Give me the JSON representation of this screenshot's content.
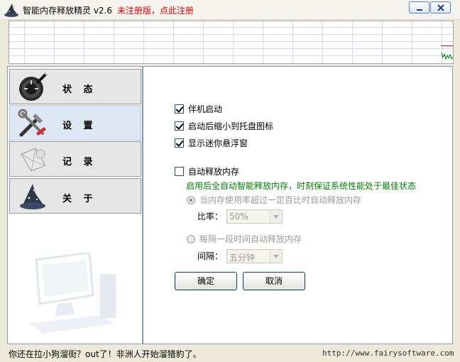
{
  "window": {
    "title": "智能内存释放精灵 v2.6",
    "register_link": "未注册版，点此注册"
  },
  "sidebar": {
    "items": [
      {
        "label": "状 态",
        "icon": "gauge-wand-icon"
      },
      {
        "label": "设 置",
        "icon": "tools-icon",
        "active": true
      },
      {
        "label": "记 录",
        "icon": "envelope-icon"
      },
      {
        "label": "关 于",
        "icon": "wizard-hat-icon"
      }
    ]
  },
  "settings": {
    "autostart": {
      "label": "伴机启动",
      "checked": true
    },
    "minimize_tray": {
      "label": "启动后缩小到托盘图标",
      "checked": true
    },
    "mini_float": {
      "label": "显示迷你悬浮窗",
      "checked": true
    },
    "auto_release": {
      "label": "自动释放内存",
      "checked": false
    },
    "auto_hint": "启用后全自动智能释放内存，时刻保证系统性能处于最佳状态",
    "mode_ratio": {
      "label": "当内存使用率超过一定百比时自动释放内存",
      "selected": true
    },
    "ratio_label": "比率：",
    "ratio_value": "50%",
    "mode_interval": {
      "label": "每隔一段时间自动释放内存",
      "selected": false
    },
    "interval_label": "间隔：",
    "interval_value": "五分钟",
    "ok_label": "确定",
    "cancel_label": "取消"
  },
  "status": {
    "message": "你还在拉小狗溜街？out了！非洲人开始溜猎豹了。",
    "url": "http://www.fairysoftware.com"
  },
  "colors": {
    "register": "#e00000",
    "hint": "#008000",
    "graph_grid": "#d0d8f0",
    "graph_line": "#008000",
    "graph_marker": "#ff0000"
  }
}
